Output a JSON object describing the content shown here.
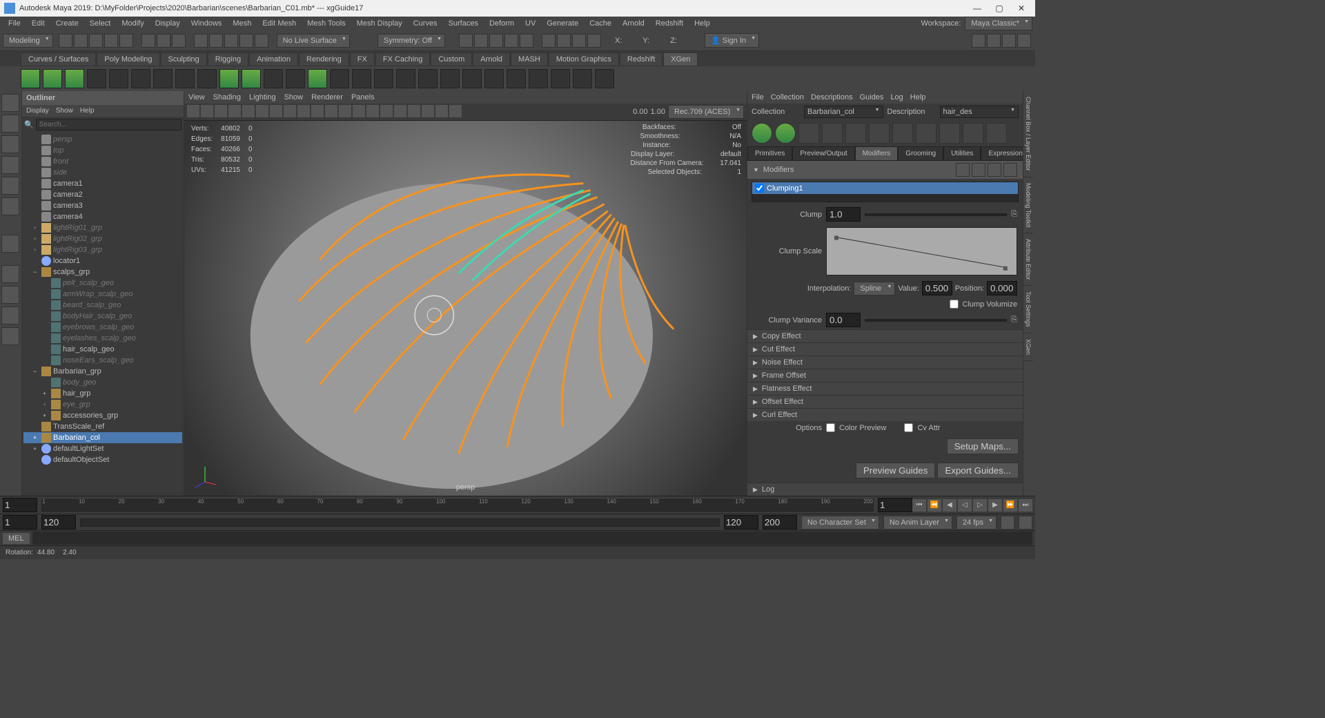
{
  "title": "Autodesk Maya 2019: D:\\MyFolder\\Projects\\2020\\Barbarian\\scenes\\Barbarian_C01.mb*  ---  xgGuide17",
  "workspace": {
    "label": "Workspace:",
    "value": "Maya Classic*"
  },
  "menubar": [
    "File",
    "Edit",
    "Create",
    "Select",
    "Modify",
    "Display",
    "Windows",
    "Mesh",
    "Edit Mesh",
    "Mesh Tools",
    "Mesh Display",
    "Curves",
    "Surfaces",
    "Deform",
    "UV",
    "Generate",
    "Cache",
    "Arnold",
    "Redshift",
    "Help"
  ],
  "mode_dropdown": "Modeling",
  "shelf_row": {
    "no_live": "No Live Surface",
    "symmetry": "Symmetry: Off",
    "signin": "Sign In",
    "x": "X:",
    "y": "Y:",
    "z": "Z:"
  },
  "shelf_tabs": [
    "Curves / Surfaces",
    "Poly Modeling",
    "Sculpting",
    "Rigging",
    "Animation",
    "Rendering",
    "FX",
    "FX Caching",
    "Custom",
    "Arnold",
    "MASH",
    "Motion Graphics",
    "Redshift",
    "XGen"
  ],
  "shelf_active": "XGen",
  "outliner": {
    "title": "Outliner",
    "menu": [
      "Display",
      "Show",
      "Help"
    ],
    "search": "Search...",
    "items": [
      {
        "label": "persp",
        "icon": "cam",
        "dim": true,
        "indent": 1
      },
      {
        "label": "top",
        "icon": "cam",
        "dim": true,
        "indent": 1
      },
      {
        "label": "front",
        "icon": "cam",
        "dim": true,
        "indent": 1
      },
      {
        "label": "side",
        "icon": "cam",
        "dim": true,
        "indent": 1
      },
      {
        "label": "camera1",
        "icon": "cam",
        "indent": 1
      },
      {
        "label": "camera2",
        "icon": "cam",
        "indent": 1
      },
      {
        "label": "camera3",
        "icon": "cam",
        "indent": 1
      },
      {
        "label": "camera4",
        "icon": "cam",
        "indent": 1
      },
      {
        "label": "lightRig01_grp",
        "icon": "light",
        "dim": true,
        "exp": "+",
        "indent": 1
      },
      {
        "label": "lightRig02_grp",
        "icon": "light",
        "dim": true,
        "exp": "+",
        "indent": 1
      },
      {
        "label": "lightRig03_grp",
        "icon": "light",
        "dim": true,
        "exp": "+",
        "indent": 1
      },
      {
        "label": "locator1",
        "icon": "set",
        "indent": 1
      },
      {
        "label": "scalps_grp",
        "icon": "grp",
        "exp": "−",
        "indent": 1
      },
      {
        "label": "pelt_scalp_geo",
        "icon": "geo",
        "dim": true,
        "indent": 2
      },
      {
        "label": "armWrap_scalp_geo",
        "icon": "geo",
        "dim": true,
        "indent": 2
      },
      {
        "label": "beard_scalp_geo",
        "icon": "geo",
        "dim": true,
        "indent": 2
      },
      {
        "label": "bodyHair_scalp_geo",
        "icon": "geo",
        "dim": true,
        "indent": 2
      },
      {
        "label": "eyebrows_scalp_geo",
        "icon": "geo",
        "dim": true,
        "indent": 2
      },
      {
        "label": "eyelashes_scalp_geo",
        "icon": "geo",
        "dim": true,
        "indent": 2
      },
      {
        "label": "hair_scalp_geo",
        "icon": "geo",
        "indent": 2
      },
      {
        "label": "noseEars_scalp_geo",
        "icon": "geo",
        "dim": true,
        "indent": 2
      },
      {
        "label": "Barbarian_grp",
        "icon": "grp",
        "exp": "−",
        "indent": 1
      },
      {
        "label": "body_geo",
        "icon": "geo",
        "dim": true,
        "indent": 2
      },
      {
        "label": "hair_grp",
        "icon": "grp",
        "exp": "+",
        "indent": 2
      },
      {
        "label": "eye_grp",
        "icon": "grp",
        "dim": true,
        "exp": "+",
        "indent": 2
      },
      {
        "label": "accessories_grp",
        "icon": "grp",
        "exp": "+",
        "indent": 2
      },
      {
        "label": "TransScale_ref",
        "icon": "grp",
        "indent": 1
      },
      {
        "label": "Barbarian_col",
        "icon": "grp",
        "exp": "+",
        "indent": 1,
        "sel": true
      },
      {
        "label": "defaultLightSet",
        "icon": "set",
        "exp": "+",
        "indent": 1
      },
      {
        "label": "defaultObjectSet",
        "icon": "set",
        "indent": 1
      }
    ]
  },
  "viewport": {
    "menu": [
      "View",
      "Shading",
      "Lighting",
      "Show",
      "Renderer",
      "Panels"
    ],
    "colorspace": "Rec.709 (ACES)",
    "exposure": "0.00",
    "gamma": "1.00",
    "stats": [
      {
        "k": "Verts:",
        "a": "40802",
        "b": "0"
      },
      {
        "k": "Edges:",
        "a": "81059",
        "b": "0"
      },
      {
        "k": "Faces:",
        "a": "40266",
        "b": "0"
      },
      {
        "k": "Tris:",
        "a": "80532",
        "b": "0"
      },
      {
        "k": "UVs:",
        "a": "41215",
        "b": "0"
      }
    ],
    "info": [
      {
        "k": "Backfaces:",
        "v": "Off"
      },
      {
        "k": "Smoothness:",
        "v": "N/A"
      },
      {
        "k": "Instance:",
        "v": "No"
      },
      {
        "k": "Display Layer:",
        "v": "default"
      },
      {
        "k": "Distance From Camera:",
        "v": "17.041"
      },
      {
        "k": "Selected Objects:",
        "v": "1"
      }
    ],
    "camera": "persp"
  },
  "xgen": {
    "menu": [
      "File",
      "Collection",
      "Descriptions",
      "Guides",
      "Log",
      "Help"
    ],
    "collection_lbl": "Collection",
    "collection": "Barbarian_col",
    "description_lbl": "Description",
    "description": "hair_des",
    "tabs": [
      "Primitives",
      "Preview/Output",
      "Modifiers",
      "Grooming",
      "Utilities",
      "Expressions"
    ],
    "tab_active": "Modifiers",
    "section": "Modifiers",
    "mod_item": "Clumping1",
    "clump_lbl": "Clump",
    "clump_val": "1.0",
    "clump_scale_lbl": "Clump Scale",
    "interp_lbl": "Interpolation:",
    "interp_val": "Spline",
    "value_lbl": "Value:",
    "value_val": "0.500",
    "position_lbl": "Position:",
    "position_val": "0.000",
    "volumize_lbl": "Clump Volumize",
    "variance_lbl": "Clump Variance",
    "variance_val": "0.0",
    "effects": [
      "Copy Effect",
      "Cut Effect",
      "Noise Effect",
      "Frame Offset",
      "Flatness Effect",
      "Offset Effect",
      "Curl Effect"
    ],
    "options_lbl": "Options",
    "color_preview": "Color Preview",
    "cv_attr": "Cv Attr",
    "setup_maps": "Setup Maps...",
    "preview_guides": "Preview Guides",
    "export_guides": "Export Guides...",
    "log": "Log"
  },
  "right_tabs": [
    "Channel Box / Layer Editor",
    "Modeling Toolkit",
    "Attribute Editor",
    "Tool Settings",
    "XGen"
  ],
  "timeline": {
    "start": "1",
    "end": "200",
    "ticks": [
      "1",
      "10",
      "20",
      "30",
      "40",
      "50",
      "60",
      "70",
      "80",
      "90",
      "100",
      "110",
      "120",
      "130",
      "140",
      "150",
      "160",
      "170",
      "180",
      "190",
      "200"
    ]
  },
  "range": {
    "r1": "1",
    "r2": "120",
    "r3": "120",
    "r4": "200",
    "charset": "No Character Set",
    "animlayer": "No Anim Layer",
    "fps": "24 fps"
  },
  "cmd": {
    "lang": "MEL"
  },
  "status": {
    "rotation_lbl": "Rotation:",
    "rx": "44.80",
    "ry": "2.40"
  }
}
